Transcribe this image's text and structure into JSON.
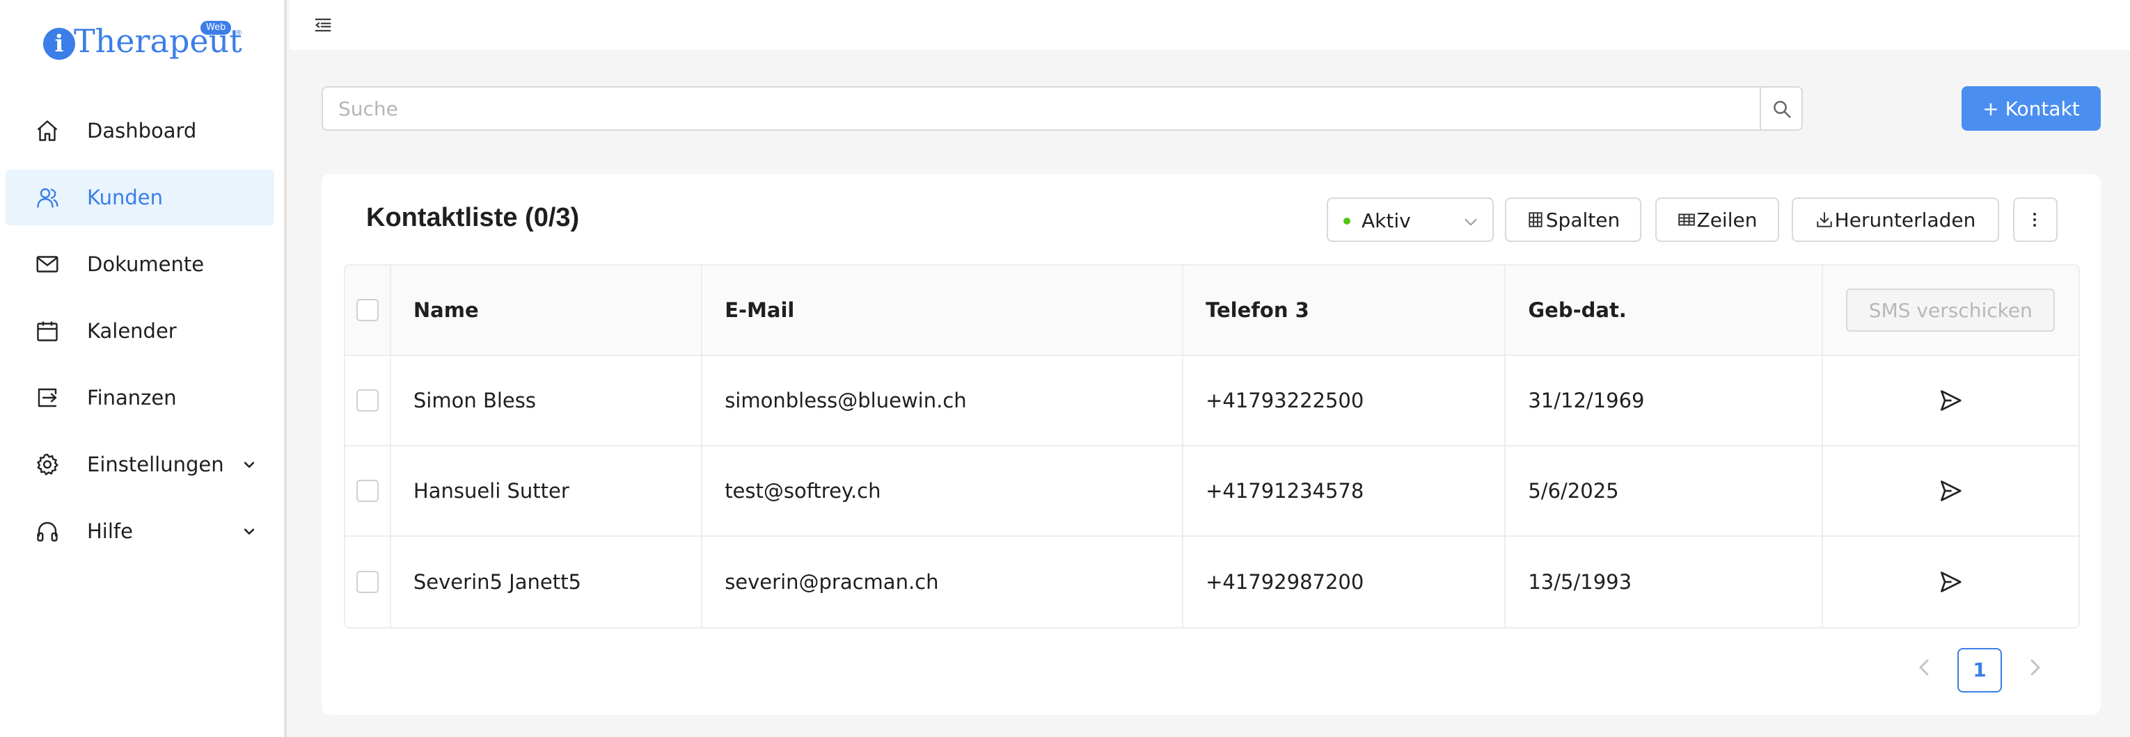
{
  "brand": {
    "name": "Therapeut",
    "badge": "Web",
    "registered": "®"
  },
  "sidebar": {
    "items": [
      {
        "label": "Dashboard",
        "icon": "home-icon"
      },
      {
        "label": "Kunden",
        "icon": "users-icon",
        "active": true
      },
      {
        "label": "Dokumente",
        "icon": "mail-icon"
      },
      {
        "label": "Kalender",
        "icon": "calendar-icon"
      },
      {
        "label": "Finanzen",
        "icon": "transfer-icon"
      },
      {
        "label": "Einstellungen",
        "icon": "gear-icon",
        "expandable": true
      },
      {
        "label": "Hilfe",
        "icon": "headphones-icon",
        "expandable": true
      }
    ]
  },
  "search": {
    "placeholder": "Suche",
    "value": ""
  },
  "actions": {
    "add_contact": "+ Kontakt"
  },
  "card": {
    "title": "Kontaktliste (0/3)",
    "status_filter": "Aktiv",
    "columns_button": "Spalten",
    "rows_button": "Zeilen",
    "download_button": "Herunterladen"
  },
  "table": {
    "headers": [
      "Name",
      "E-Mail",
      "Telefon 3",
      "Geb-dat."
    ],
    "sms_button": "SMS verschicken",
    "rows": [
      {
        "name": "Simon Bless",
        "email": "simonbless@bluewin.ch",
        "phone": "+41793222500",
        "birthdate": "31/12/1969"
      },
      {
        "name": "Hansueli Sutter",
        "email": "test@softrey.ch",
        "phone": "+41791234578",
        "birthdate": "5/6/2025"
      },
      {
        "name": "Severin5 Janett5",
        "email": "severin@pracman.ch",
        "phone": "+41792987200",
        "birthdate": "13/5/1993"
      }
    ]
  },
  "pagination": {
    "current_page": "1"
  },
  "colors": {
    "accent": "#3b7ee8",
    "active_bg": "#e9f4fd",
    "status_dot": "#52c41a"
  }
}
